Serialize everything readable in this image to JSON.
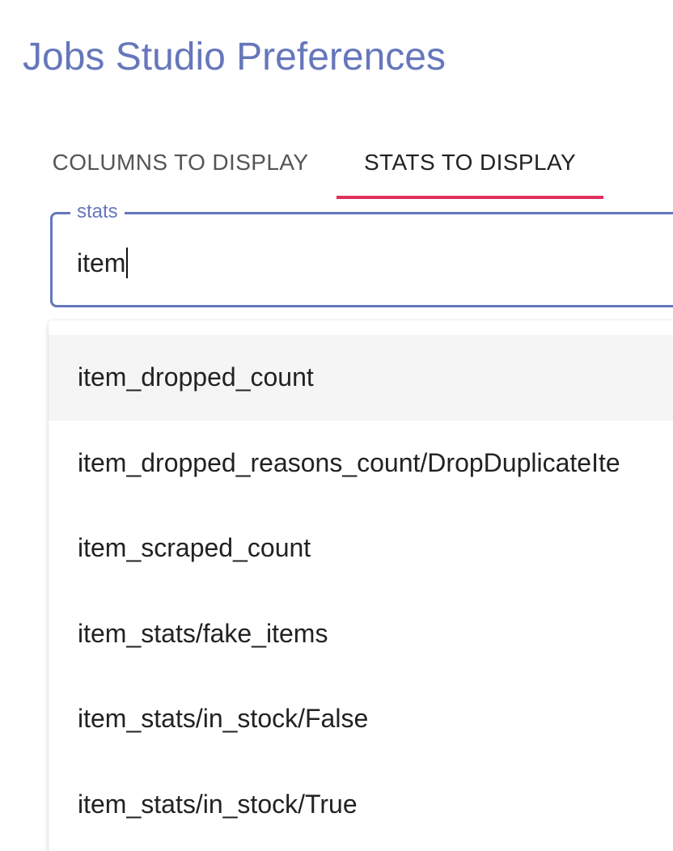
{
  "header": {
    "title": "Jobs Studio Preferences"
  },
  "tabs": [
    {
      "label": "COLUMNS TO DISPLAY",
      "selected": false
    },
    {
      "label": "STATS TO DISPLAY",
      "selected": true
    }
  ],
  "stats_field": {
    "label": "stats",
    "value": "item"
  },
  "dropdown": {
    "options": [
      {
        "label": "item_dropped_count",
        "highlighted": true
      },
      {
        "label": "item_dropped_reasons_count/DropDuplicateIte",
        "highlighted": false
      },
      {
        "label": "item_scraped_count",
        "highlighted": false
      },
      {
        "label": "item_stats/fake_items",
        "highlighted": false
      },
      {
        "label": "item_stats/in_stock/False",
        "highlighted": false
      },
      {
        "label": "item_stats/in_stock/True",
        "highlighted": false
      }
    ]
  },
  "colors": {
    "primary": "#6677bb",
    "tab_indicator": "#e0305d",
    "highlight_bg": "#f5f5f5"
  }
}
